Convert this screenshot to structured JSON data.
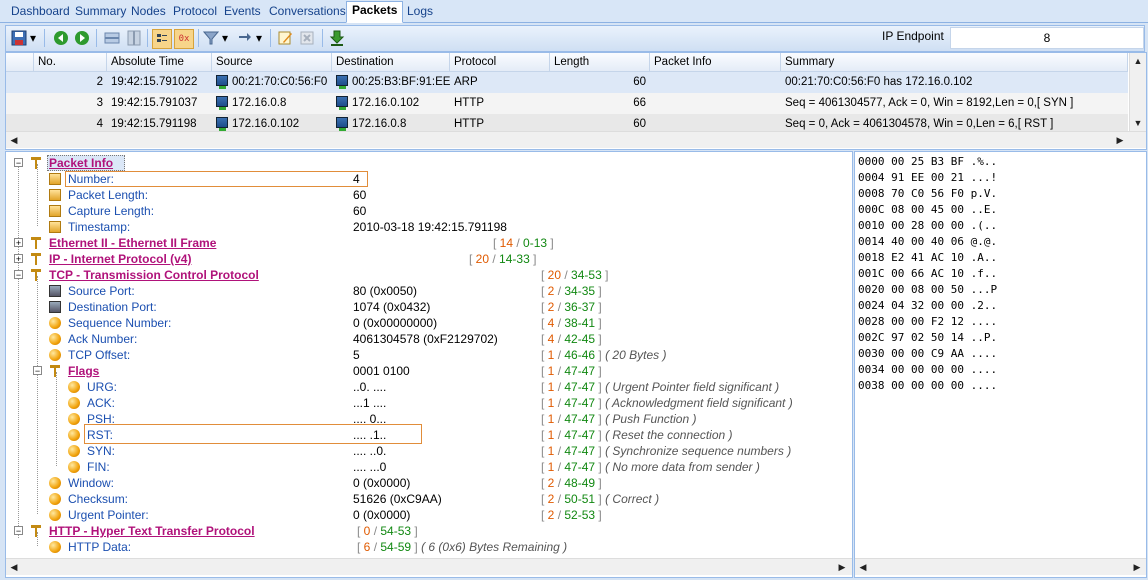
{
  "tabs": [
    "Dashboard",
    "Summary",
    "Nodes",
    "Protocol",
    "Events",
    "Conversations",
    "Packets",
    "Logs"
  ],
  "active_tab": "Packets",
  "toolbar": {
    "ip_endpoint_label": "IP Endpoint",
    "ip_endpoint_value": "8",
    "icons": [
      "save-icon",
      "dropdown-icon",
      "back-icon",
      "forward-icon",
      "layout-icon",
      "panel-icon",
      "decode-icon",
      "hex-icon",
      "filter-icon",
      "filter-dropdown-icon",
      "routes-icon",
      "routes-dropdown-icon",
      "edit-icon",
      "delete-icon",
      "download-icon"
    ]
  },
  "packet_table": {
    "columns": [
      "No.",
      "Absolute Time",
      "Source",
      "Destination",
      "Protocol",
      "Length",
      "Packet Info",
      "Summary"
    ],
    "rows": [
      {
        "no": "2",
        "time": "19:42:15.791022",
        "source": "00:21:70:C0:56:F0",
        "destination": "00:25:B3:BF:91:EE",
        "protocol": "ARP",
        "length": "60",
        "info": "",
        "summary": "00:21:70:C0:56:F0 has 172.16.0.102"
      },
      {
        "no": "3",
        "time": "19:42:15.791037",
        "source": "172.16.0.8",
        "destination": "172.16.0.102",
        "protocol": "HTTP",
        "length": "66",
        "info": "",
        "summary": "Seq = 4061304577, Ack = 0, Win = 8192,Len = 0,[ SYN ]"
      },
      {
        "no": "4",
        "time": "19:42:15.791198",
        "source": "172.16.0.102",
        "destination": "172.16.0.8",
        "protocol": "HTTP",
        "length": "60",
        "info": "",
        "summary": "Seq = 0, Ack = 4061304578, Win = 0,Len = 6,[ RST ]"
      }
    ]
  },
  "tree": {
    "packet_info": {
      "title": "Packet Info",
      "fields": [
        {
          "label": "Number:",
          "value": "4"
        },
        {
          "label": "Packet Length:",
          "value": "60"
        },
        {
          "label": "Capture Length:",
          "value": "60"
        },
        {
          "label": "Timestamp:",
          "value": "2010-03-18 19:42:15.791198"
        }
      ]
    },
    "ethernet": {
      "title": "Ethernet II - Ethernet II Frame",
      "len": "14",
      "range": "0-13"
    },
    "ip": {
      "title": "IP - Internet Protocol (v4)",
      "len": "20",
      "range": "14-33"
    },
    "tcp": {
      "title": "TCP - Transmission Control Protocol",
      "len": "20",
      "range": "34-53",
      "fields": [
        {
          "label": "Source Port:",
          "value": "80 (0x0050)",
          "len": "2",
          "range": "34-35",
          "comment": ""
        },
        {
          "label": "Destination Port:",
          "value": "1074 (0x0432)",
          "len": "2",
          "range": "36-37",
          "comment": ""
        },
        {
          "label": "Sequence Number:",
          "value": "0 (0x00000000)",
          "len": "4",
          "range": "38-41",
          "comment": ""
        },
        {
          "label": "Ack Number:",
          "value": "4061304578 (0xF2129702)",
          "len": "4",
          "range": "42-45",
          "comment": ""
        },
        {
          "label": "TCP Offset:",
          "value": "5",
          "len": "1",
          "range": "46-46",
          "comment": "20 Bytes"
        }
      ],
      "flags": {
        "title": "Flags",
        "value": "0001 0100",
        "len": "1",
        "range": "47-47",
        "items": [
          {
            "label": "URG:",
            "value": "..0. ....",
            "comment": "Urgent Pointer field significant"
          },
          {
            "label": "ACK:",
            "value": "...1 ....",
            "comment": "Acknowledgment field significant"
          },
          {
            "label": "PSH:",
            "value": ".... 0...",
            "comment": "Push Function"
          },
          {
            "label": "RST:",
            "value": ".... .1..",
            "comment": "Reset the connection"
          },
          {
            "label": "SYN:",
            "value": ".... ..0.",
            "comment": "Synchronize sequence numbers"
          },
          {
            "label": "FIN:",
            "value": ".... ...0",
            "comment": "No more data from sender"
          }
        ],
        "item_len": "1",
        "item_range": "47-47"
      },
      "fields2": [
        {
          "label": "Window:",
          "value": "0 (0x0000)",
          "len": "2",
          "range": "48-49",
          "comment": ""
        },
        {
          "label": "Checksum:",
          "value": "51626 (0xC9AA)",
          "len": "2",
          "range": "50-51",
          "comment": "Correct"
        },
        {
          "label": "Urgent Pointer:",
          "value": "0 (0x0000)",
          "len": "2",
          "range": "52-53",
          "comment": ""
        }
      ]
    },
    "http": {
      "title": "HTTP - Hyper Text Transfer Protocol",
      "len": "0",
      "range": "54-53",
      "data": {
        "label": "HTTP Data:",
        "len": "6",
        "range": "54-59",
        "comment": "6 (0x6) Bytes Remaining"
      }
    }
  },
  "hex": [
    "0000 00 25 B3 BF .%..",
    "0004 91 EE 00 21 ...!",
    "0008 70 C0 56 F0 p.V.",
    "000C 08 00 45 00 ..E.",
    "0010 00 28 00 00 .(..",
    "0014 40 00 40 06 @.@.",
    "0018 E2 41 AC 10 .A..",
    "001C 00 66 AC 10 .f..",
    "0020 00 08 00 50 ...P",
    "0024 04 32 00 00 .2..",
    "0028 00 00 F2 12 ....",
    "002C 97 02 50 14 ..P.",
    "0030 00 00 C9 AA ....",
    "0034 00 00 00 00 ....",
    "0038 00 00 00 00 ...."
  ]
}
